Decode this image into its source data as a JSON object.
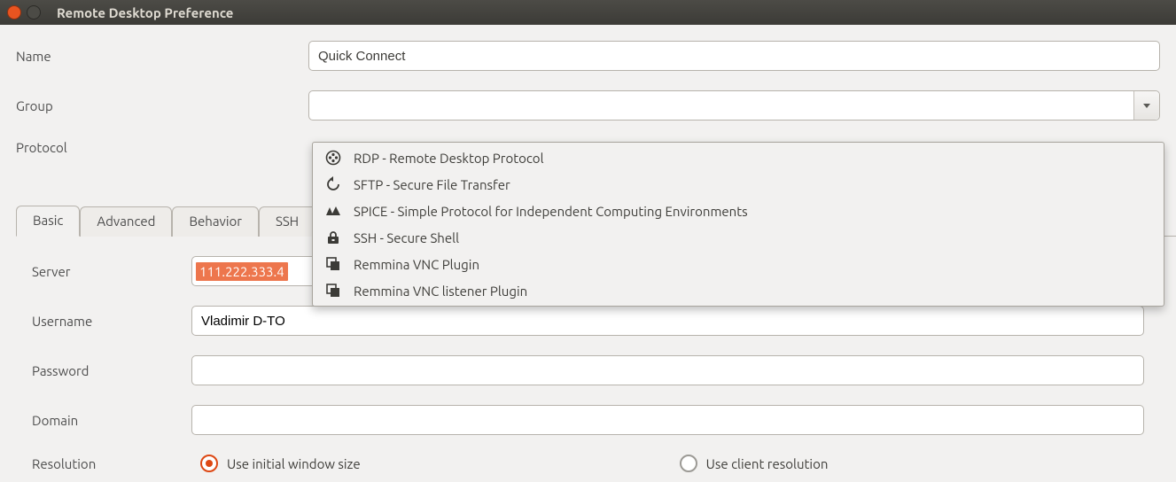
{
  "window": {
    "title": "Remote Desktop Preference"
  },
  "form": {
    "name": {
      "label": "Name",
      "value": "Quick Connect"
    },
    "group": {
      "label": "Group",
      "value": ""
    },
    "protocol": {
      "label": "Protocol"
    }
  },
  "protocol_options": [
    {
      "icon": "rdp",
      "label": "RDP - Remote Desktop Protocol"
    },
    {
      "icon": "sftp",
      "label": "SFTP - Secure File Transfer"
    },
    {
      "icon": "spice",
      "label": "SPICE - Simple Protocol for Independent Computing Environments"
    },
    {
      "icon": "ssh",
      "label": "SSH - Secure Shell"
    },
    {
      "icon": "vnc",
      "label": "Remmina VNC Plugin"
    },
    {
      "icon": "vncl",
      "label": "Remmina VNC listener Plugin"
    }
  ],
  "tabs": {
    "items": [
      "Basic",
      "Advanced",
      "Behavior",
      "SSH"
    ],
    "active": "Basic"
  },
  "basic": {
    "server": {
      "label": "Server",
      "value": "111.222.333.4"
    },
    "username": {
      "label": "Username",
      "value": "Vladimir D-TO"
    },
    "password": {
      "label": "Password",
      "value": ""
    },
    "domain": {
      "label": "Domain",
      "value": ""
    },
    "resolution": {
      "label": "Resolution",
      "options": [
        "Use initial window size",
        "Use client resolution"
      ],
      "selected": 0
    }
  }
}
